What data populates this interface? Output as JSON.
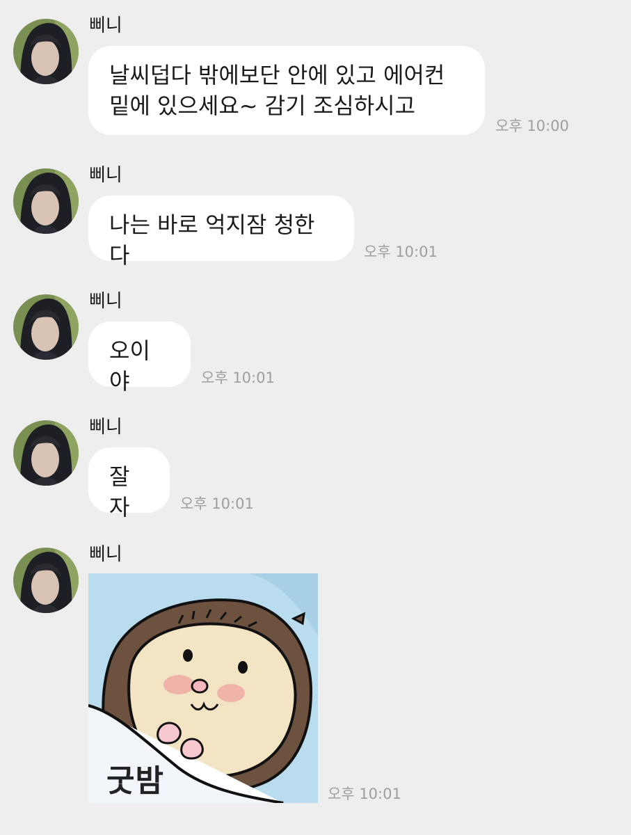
{
  "messages": [
    {
      "sender": "삐니",
      "text": "날씨덥다 밖에보단 안에 있고 에어컨\n밑에 있으세요~ 감기 조심하시고",
      "time": "오후 10:00"
    },
    {
      "sender": "삐니",
      "text": "나는 바로 억지잠 청한다",
      "time": "오후 10:01"
    },
    {
      "sender": "삐니",
      "text": "오이야",
      "time": "오후 10:01"
    },
    {
      "sender": "삐니",
      "text": "잘자",
      "time": "오후 10:01"
    },
    {
      "sender": "삐니",
      "sticker_text": "굿밤",
      "sticker_icon": "hedgehog-sticker",
      "time": "오후 10:01"
    }
  ],
  "colors": {
    "background": "#eeeeee",
    "bubble": "#ffffff",
    "timestamp": "#9e9e9e",
    "sticker_bg": "#b9dcef",
    "hedgehog_spikes": "#6e5240",
    "hedgehog_face": "#f3e4c4"
  }
}
